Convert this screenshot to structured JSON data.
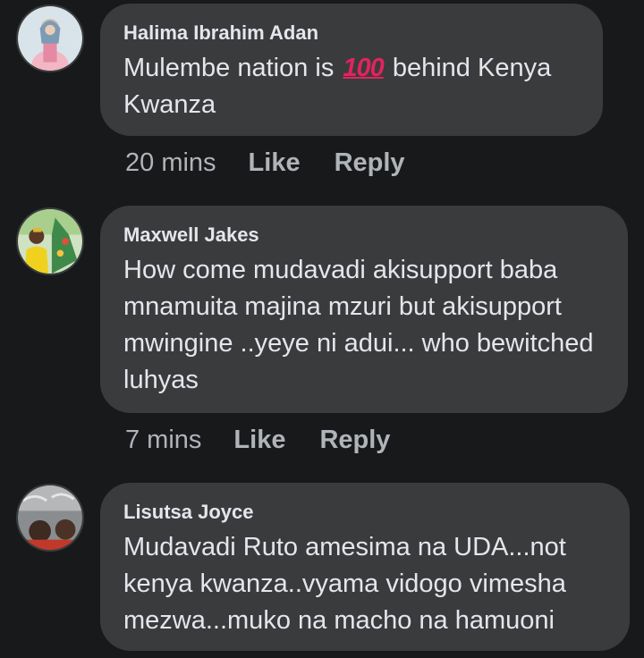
{
  "comments": [
    {
      "author": "Halima Ibrahim Adan",
      "text_before": "Mulembe nation is ",
      "emoji": "100",
      "text_after": " behind Kenya Kwanza",
      "time": "20 mins",
      "like_label": "Like",
      "reply_label": "Reply"
    },
    {
      "author": "Maxwell Jakes",
      "text": "How come mudavadi akisupport baba mnamuita majina mzuri but akisupport mwingine ..yeye ni adui... who bewitched luhyas",
      "time": "7 mins",
      "like_label": "Like",
      "reply_label": "Reply"
    },
    {
      "author": "Lisutsa Joyce",
      "text": "Mudavadi Ruto amesima na UDA...not kenya kwanza..vyama vidogo vimesha mezwa...muko na macho na hamuoni"
    }
  ],
  "colors": {
    "background": "#18191a",
    "bubble": "#3a3b3c",
    "text": "#e4e6eb",
    "secondary": "#b0b3b8",
    "emoji_red": "#e0245e"
  },
  "icons": [
    "hundred-points-emoji"
  ]
}
